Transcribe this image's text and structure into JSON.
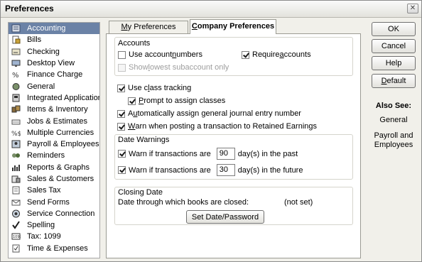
{
  "window": {
    "title": "Preferences",
    "close_glyph": "✕"
  },
  "sidebar": {
    "items": [
      {
        "label": "Accounting",
        "icon": "accounting-icon",
        "selected": true
      },
      {
        "label": "Bills",
        "icon": "bills-icon"
      },
      {
        "label": "Checking",
        "icon": "checking-icon"
      },
      {
        "label": "Desktop View",
        "icon": "desktop-view-icon"
      },
      {
        "label": "Finance Charge",
        "icon": "finance-charge-icon"
      },
      {
        "label": "General",
        "icon": "general-icon"
      },
      {
        "label": "Integrated Applications",
        "icon": "integrated-apps-icon"
      },
      {
        "label": "Items & Inventory",
        "icon": "items-inventory-icon"
      },
      {
        "label": "Jobs & Estimates",
        "icon": "jobs-estimates-icon"
      },
      {
        "label": "Multiple Currencies",
        "icon": "currencies-icon"
      },
      {
        "label": "Payroll & Employees",
        "icon": "payroll-icon"
      },
      {
        "label": "Reminders",
        "icon": "reminders-icon"
      },
      {
        "label": "Reports & Graphs",
        "icon": "reports-graphs-icon"
      },
      {
        "label": "Sales & Customers",
        "icon": "sales-customers-icon"
      },
      {
        "label": "Sales Tax",
        "icon": "sales-tax-icon"
      },
      {
        "label": "Send Forms",
        "icon": "send-forms-icon"
      },
      {
        "label": "Service Connection",
        "icon": "service-connection-icon"
      },
      {
        "label": "Spelling",
        "icon": "spelling-icon"
      },
      {
        "label": "Tax: 1099",
        "icon": "tax-1099-icon"
      },
      {
        "label": "Time & Expenses",
        "icon": "time-expenses-icon"
      }
    ]
  },
  "tabs": {
    "my": {
      "hotkey": "M",
      "rest": "y Preferences"
    },
    "company": {
      "hotkey": "C",
      "rest": "ompany Preferences"
    }
  },
  "accounts": {
    "title": "Accounts",
    "use_account_numbers": {
      "pre": "Use account ",
      "hotkey": "n",
      "post": "umbers",
      "checked": false
    },
    "require_accounts": {
      "pre": "Require ",
      "hotkey": "a",
      "post": "ccounts",
      "checked": true
    },
    "show_lowest": {
      "pre": "Show ",
      "hotkey": "l",
      "post": "owest subaccount only",
      "checked": false,
      "disabled": true
    }
  },
  "class_tracking": {
    "pre": "Use c",
    "hotkey": "l",
    "post": "ass tracking",
    "checked": true
  },
  "prompt_classes": {
    "pre": "",
    "hotkey": "P",
    "post": "rompt to assign classes",
    "checked": true
  },
  "auto_journal": {
    "pre": "A",
    "hotkey": "u",
    "post": "tomatically assign general journal entry number",
    "checked": true
  },
  "warn_retained": {
    "pre": "",
    "hotkey": "W",
    "post": "arn when posting a transaction to Retained Earnings",
    "checked": true
  },
  "date_warnings": {
    "title": "Date Warnings",
    "past": {
      "label": "Warn if transactions are",
      "value": "90",
      "suffix": "day(s) in the past",
      "checked": true
    },
    "future": {
      "label": "Warn if transactions are",
      "value": "30",
      "suffix": "day(s) in the future",
      "checked": true
    }
  },
  "closing_date": {
    "title": "Closing Date",
    "label": "Date through which books are closed:",
    "value": "(not set)",
    "button": "Set Date/Password"
  },
  "buttons": {
    "ok": "OK",
    "cancel": "Cancel",
    "help": "Help",
    "default_hotkey": "D",
    "default_rest": "efault"
  },
  "also_see": {
    "title": "Also See:",
    "links": [
      "General",
      "Payroll and Employees"
    ]
  },
  "colors": {
    "selection": "#6b82a6",
    "panel_bg": "#ffffff",
    "window_bg": "#f1f0ea"
  }
}
